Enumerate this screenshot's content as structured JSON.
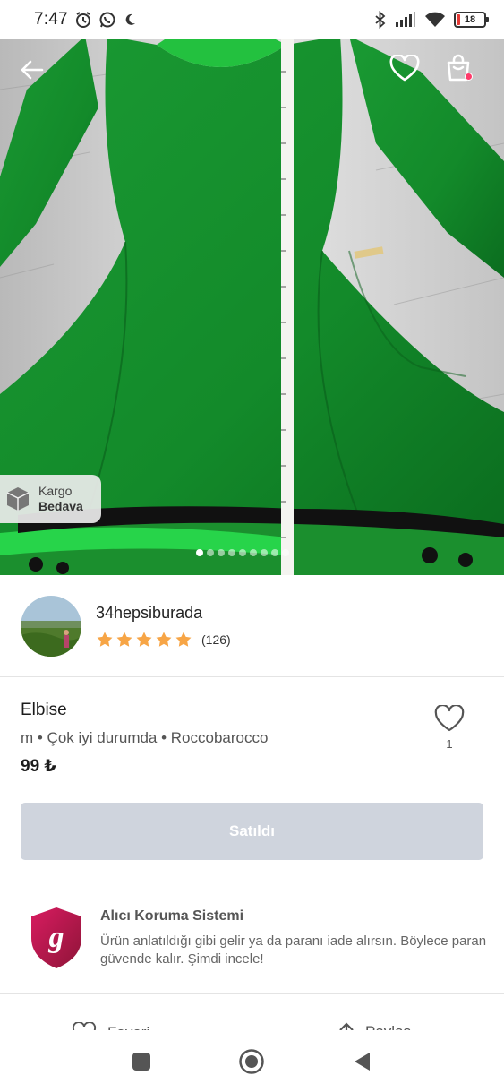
{
  "status_bar": {
    "time": "7:47",
    "battery": "18"
  },
  "hero": {
    "kargo_line1": "Kargo",
    "kargo_line2": "Bedava",
    "image_count": 9,
    "active_index": 0
  },
  "seller": {
    "name": "34hepsiburada",
    "rating": 5,
    "review_count": "(126)"
  },
  "product": {
    "title": "Elbise",
    "meta": "m • Çok iyi durumda • Roccobarocco",
    "price": "99 ₺",
    "like_count": "1"
  },
  "sold_button": {
    "label": "Satıldı"
  },
  "protection": {
    "title": "Alıcı Koruma Sistemi",
    "text": "Ürün anlatıldığı gibi gelir ya da paranı iade alırsın. Böylece paran güvende kalır. Şimdi incele!"
  },
  "action_bar": {
    "favorite_label": "Favori",
    "share_label": "Paylaş"
  },
  "colors": {
    "dress_green": "#138a2a",
    "sold_button": "#cfd4dd",
    "star": "#f7a546",
    "shield": "#c2185b"
  }
}
